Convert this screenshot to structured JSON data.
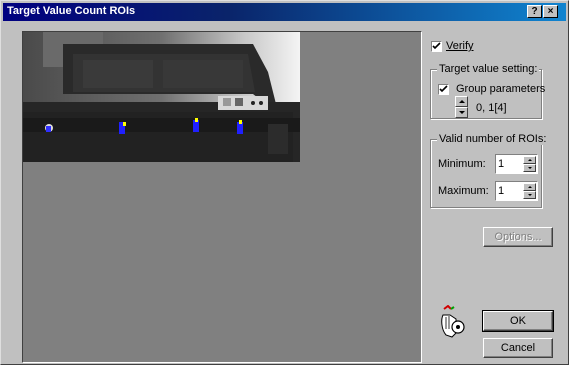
{
  "window": {
    "title": "Target Value Count ROIs",
    "help_button": "?",
    "close_button": "×"
  },
  "verify": {
    "label": "Verify",
    "checked": true
  },
  "target_value": {
    "group_title": "Target value setting:",
    "group_params_label": "Group parameters",
    "group_params_checked": true,
    "value_text": "0, 1[4]"
  },
  "rois": {
    "group_title": "Valid number of ROIs:",
    "min_label": "Minimum:",
    "min_value": "1",
    "max_label": "Maximum:",
    "max_value": "1"
  },
  "buttons": {
    "options": "Options...",
    "ok": "OK",
    "cancel": "Cancel"
  },
  "icons": {
    "help": "help-icon",
    "close": "close-icon",
    "key_hand": "key-hand-icon"
  }
}
